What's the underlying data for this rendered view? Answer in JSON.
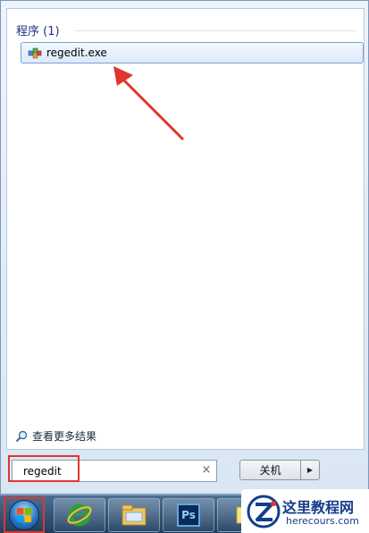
{
  "results": {
    "section_header": "程序 (1)",
    "items": [
      {
        "label": "regedit.exe",
        "icon": "registry-editor-icon"
      }
    ]
  },
  "more_results": {
    "label": "查看更多结果",
    "icon": "magnifier-icon"
  },
  "search": {
    "value": "regedit",
    "clear_icon": "×"
  },
  "shutdown": {
    "label": "关机",
    "arrow": "▶"
  },
  "taskbar": {
    "items": [
      {
        "name": "internet-explorer-icon"
      },
      {
        "name": "windows-explorer-icon"
      },
      {
        "name": "photoshop-icon",
        "label": "Ps"
      },
      {
        "name": "partial-taskbar-icon"
      }
    ]
  },
  "watermark": {
    "title": "这里教程网",
    "url": "herecours.com"
  },
  "colors": {
    "highlight_red": "#e0362d",
    "accent_blue": "#1e3287"
  }
}
